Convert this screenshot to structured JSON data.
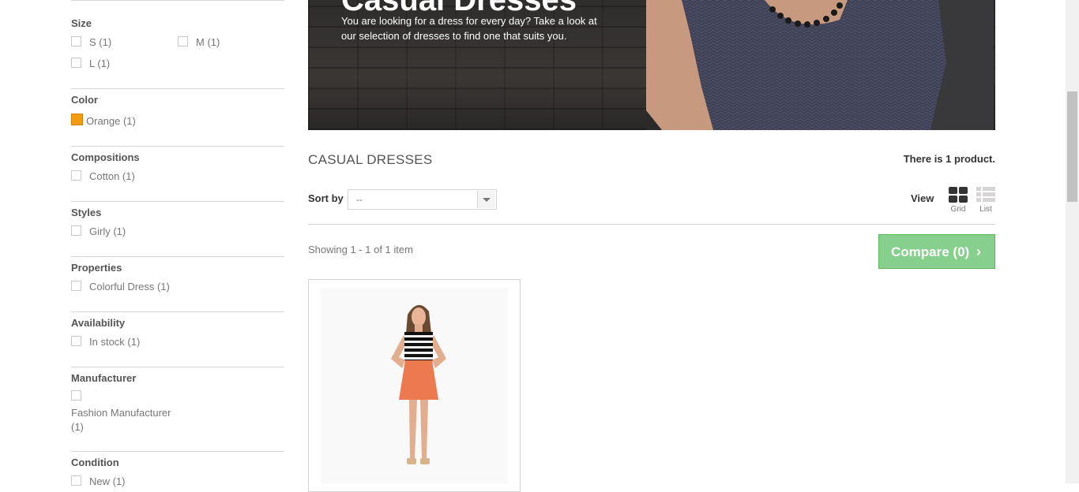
{
  "filters": {
    "size": {
      "title": "Size",
      "options": [
        {
          "label": "S (1)"
        },
        {
          "label": "M (1)"
        },
        {
          "label": "L (1)"
        }
      ]
    },
    "color": {
      "title": "Color",
      "options": [
        {
          "label": "Orange (1)",
          "swatch": "#F39C11"
        }
      ]
    },
    "compositions": {
      "title": "Compositions",
      "options": [
        {
          "label": "Cotton (1)"
        }
      ]
    },
    "styles": {
      "title": "Styles",
      "options": [
        {
          "label": "Girly (1)"
        }
      ]
    },
    "properties": {
      "title": "Properties",
      "options": [
        {
          "label": "Colorful Dress (1)"
        }
      ]
    },
    "availability": {
      "title": "Availability",
      "options": [
        {
          "label": "In stock (1)"
        }
      ]
    },
    "manufacturer": {
      "title": "Manufacturer",
      "options": [
        {
          "label_line1": "Fashion Manufacturer",
          "label_line2": "(1)"
        }
      ]
    },
    "condition": {
      "title": "Condition",
      "options": [
        {
          "label": "New (1)"
        }
      ]
    }
  },
  "banner": {
    "title": "Casual Dresses",
    "description": "You are looking for a dress for every day? Take a look at our selection of dresses to find one that suits you."
  },
  "category": {
    "title": "CASUAL DRESSES",
    "product_count": "There is 1 product."
  },
  "toolbar": {
    "sort_label": "Sort by",
    "sort_value": "--",
    "view_label": "View",
    "grid_label": "Grid",
    "list_label": "List",
    "showing": "Showing 1 - 1 of 1 item",
    "compare_label": "Compare (0)"
  },
  "colors": {
    "accent_green": "#86cf8c",
    "swatch_orange": "#F39C11"
  }
}
